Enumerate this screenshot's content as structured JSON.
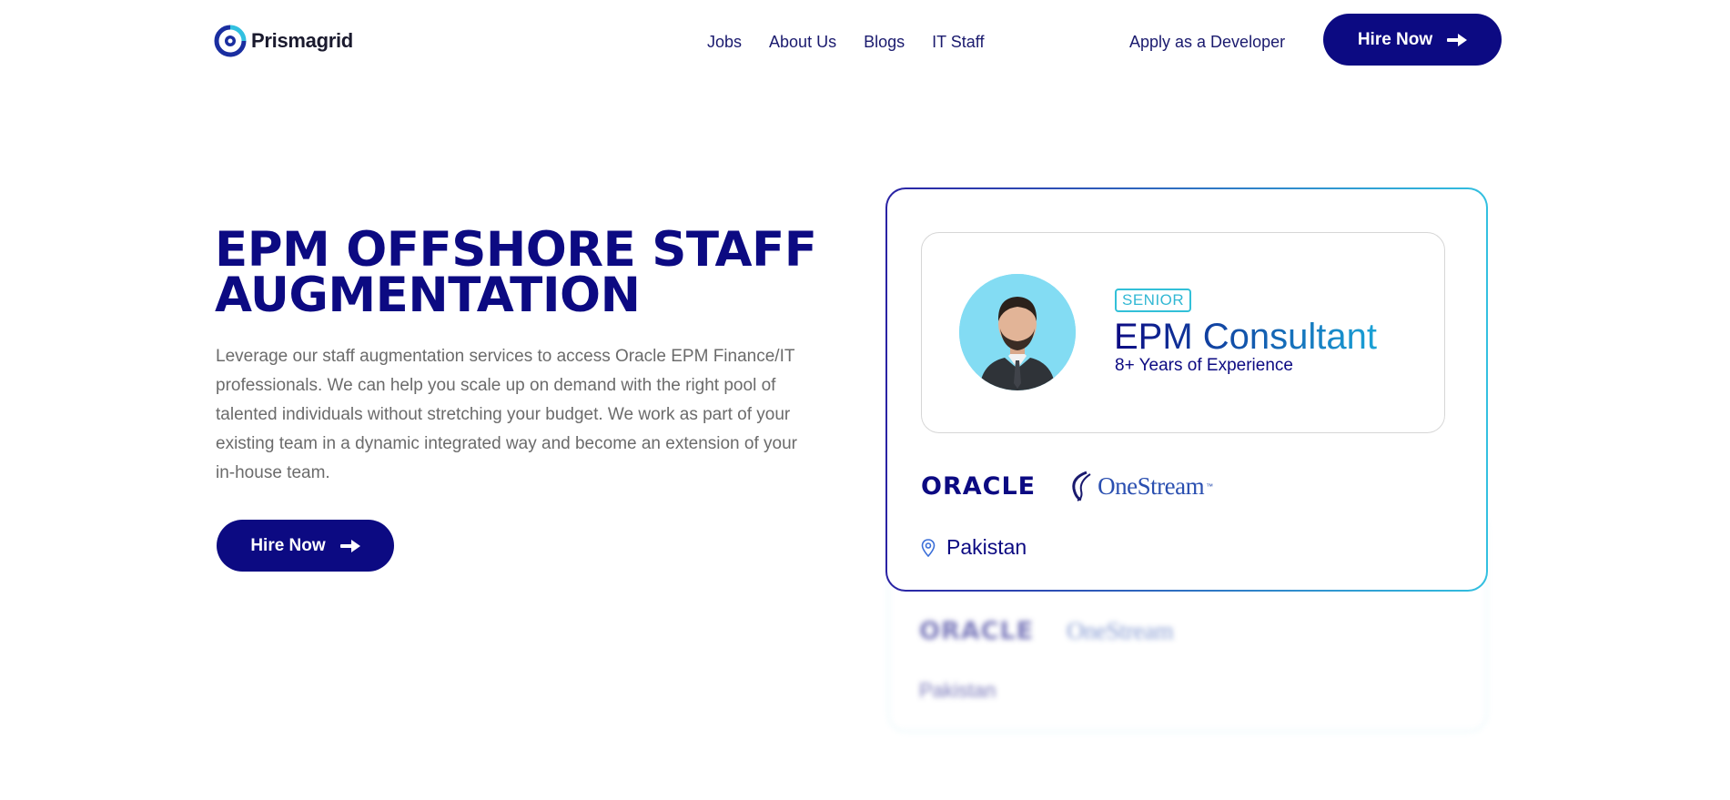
{
  "header": {
    "logo_text": "Prismagrid",
    "nav": [
      "Jobs",
      "About Us",
      "Blogs",
      "IT Staff"
    ],
    "apply_label": "Apply as a Developer",
    "hire_label": "Hire Now"
  },
  "hero": {
    "title_line1": "EPM OFFSHORE STAFF",
    "title_line2": "AUGMENTATION",
    "description": "Leverage our staff augmentation services to access Oracle EPM Finance/IT professionals. We can help you scale up on demand with the right pool of talented individuals without stretching your budget. We work as part of your existing team in a dynamic integrated way and become an extension of your in-house team.",
    "hire_label": "Hire Now"
  },
  "card": {
    "badge": "SENIOR",
    "role": "EPM Consultant",
    "experience": "8+ Years of Experience",
    "oracle_logo_text": "ORACLE",
    "onestream_logo_text": "OneStream",
    "onestream_tm": "™",
    "location": "Pakistan"
  },
  "colors": {
    "brand": "#0c0a82",
    "accent": "#32c0e0",
    "avatar_bg": "#83dcf3"
  },
  "icons": {
    "arrow": "arrow-right-icon",
    "pin": "location-pin-icon"
  }
}
